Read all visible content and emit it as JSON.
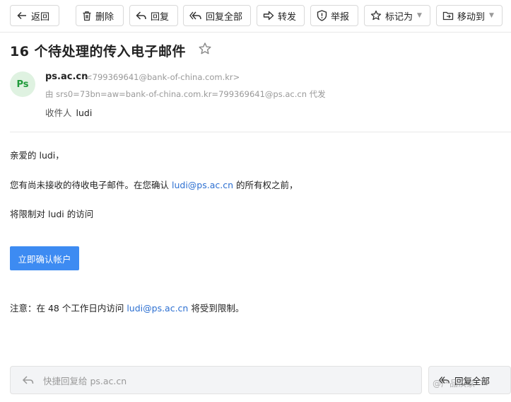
{
  "toolbar": {
    "back": "返回",
    "delete": "删除",
    "reply": "回复",
    "reply_all": "回复全部",
    "forward": "转发",
    "report": "举报",
    "mark_as": "标记为",
    "move_to": "移动到"
  },
  "email": {
    "subject": "16 个待处理的传入电子邮件",
    "avatar_text": "Ps",
    "sender_name": "ps.ac.cn",
    "sender_address": "<799369641@bank-of-china.com.kr>",
    "sent_via": "由 srs0=73bn=aw=bank-of-china.com.kr=799369641@ps.ac.cn 代发",
    "recipient_label": "收件人",
    "recipient_name": "ludi",
    "greeting": "亲爱的 ludi，",
    "line1_before": "您有尚未接收的待收电子邮件。在您确认 ",
    "line1_link": "ludi@ps.ac.cn",
    "line1_after": " 的所有权之前，",
    "line2": "将限制对 ludi 的访问",
    "confirm_button": "立即确认帐户",
    "notice_before": "注意：在 48 个工作日内访问 ",
    "notice_link": "ludi@ps.ac.cn",
    "notice_after": " 将受到限制。"
  },
  "footer": {
    "quick_reply_placeholder": "快捷回复给 ps.ac.cn",
    "reply_all": "回复全部",
    "watermark": "@产品汉家"
  },
  "colors": {
    "link": "#2c6fd1",
    "button": "#3d8bf2",
    "avatar_bg": "#dff2e1",
    "avatar_fg": "#1f9a3a"
  }
}
